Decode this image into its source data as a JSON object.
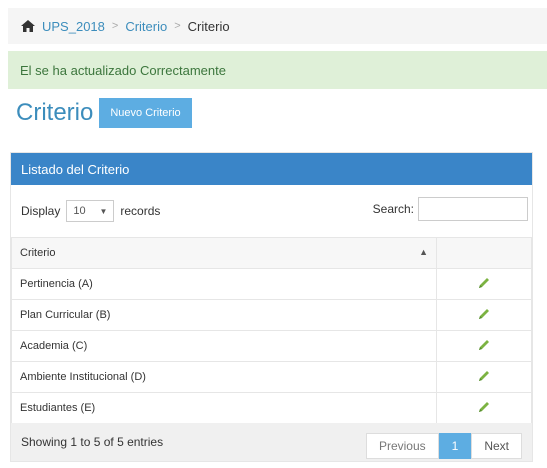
{
  "breadcrumb": {
    "home": "UPS_2018",
    "level1": "Criterio",
    "current": "Criterio"
  },
  "alert": {
    "message": "El se ha actualizado Correctamente"
  },
  "page": {
    "title": "Criterio",
    "new_button": "Nuevo Criterio"
  },
  "panel": {
    "title": "Listado del Criterio"
  },
  "controls": {
    "display_label": "Display",
    "page_size": "10",
    "records_label": "records",
    "search_label": "Search:",
    "search_value": ""
  },
  "table": {
    "columns": [
      "Criterio",
      ""
    ],
    "rows": [
      {
        "criterio": "Pertinencia (A)",
        "action_icon": "pencil-icon"
      },
      {
        "criterio": "Plan Curricular (B)",
        "action_icon": "pencil-icon"
      },
      {
        "criterio": "Academia (C)",
        "action_icon": "pencil-icon"
      },
      {
        "criterio": "Ambiente Institucional (D)",
        "action_icon": "pencil-icon"
      },
      {
        "criterio": "Estudiantes (E)",
        "action_icon": "pencil-icon"
      }
    ]
  },
  "footer": {
    "info": "Showing 1 to 5 of 5 entries",
    "previous": "Previous",
    "current_page": "1",
    "next": "Next"
  },
  "colors": {
    "link": "#3c8dbc",
    "panel_header": "#3a85c8",
    "button": "#5dade2",
    "alert_bg": "#dff0d8",
    "alert_text": "#3c763d",
    "pencil": "#7cb342"
  }
}
